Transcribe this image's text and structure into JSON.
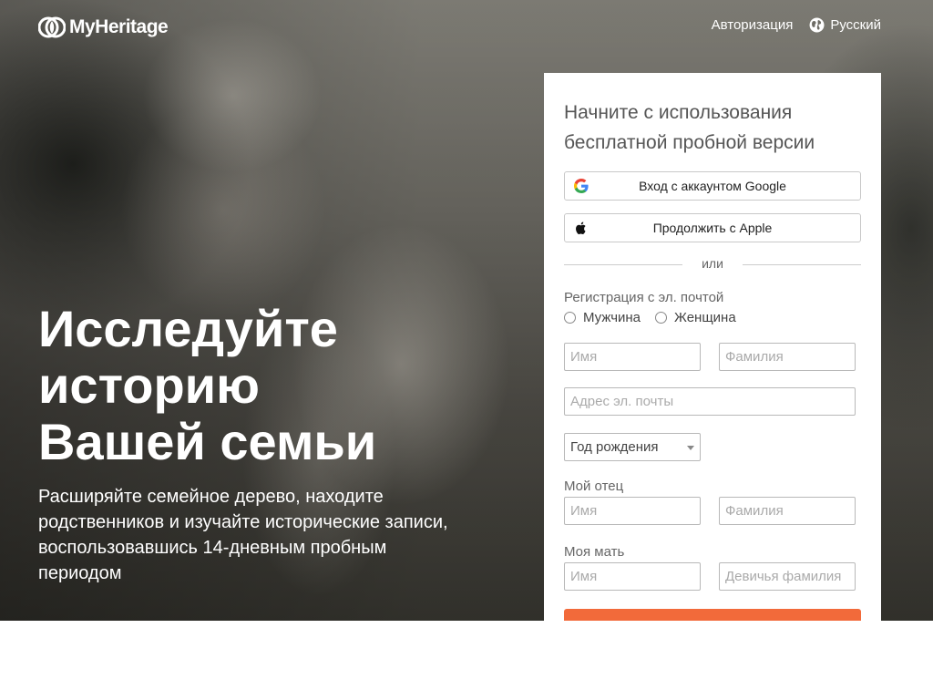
{
  "header": {
    "logo_text": "MyHeritage",
    "login_link": "Авторизация",
    "language": "Русский"
  },
  "hero": {
    "title_lines": [
      "Исследуйте",
      "историю",
      "Вашей семьи"
    ],
    "subtitle": "Расширяйте семейное дерево, находите родственников и изучайте исторические записи, воспользовавшись 14-дневным пробным периодом"
  },
  "signup": {
    "title": "Начните с использования бесплатной пробной версии",
    "google_button": "Вход с аккаунтом Google",
    "apple_button": "Продолжить с Apple",
    "divider": "или",
    "email_section_label": "Регистрация с эл. почтой",
    "gender_options": [
      "Мужчина",
      "Женщина"
    ],
    "first_name_placeholder": "Имя",
    "last_name_placeholder": "Фамилия",
    "email_placeholder": "Адрес эл. почты",
    "birth_year_select": "Год рождения",
    "father_label": "Мой отец",
    "father_first_placeholder": "Имя",
    "father_last_placeholder": "Фамилия",
    "mother_label": "Моя мать",
    "mother_first_placeholder": "Имя",
    "mother_maiden_placeholder": "Девичья фамилия"
  },
  "colors": {
    "accent": "#f26a3a",
    "panel_bg": "#ffffff",
    "hero_text": "#ffffff"
  },
  "icons": [
    "myheritage-logo-icon",
    "globe-icon",
    "google-icon",
    "apple-icon",
    "dropdown-caret-icon"
  ]
}
